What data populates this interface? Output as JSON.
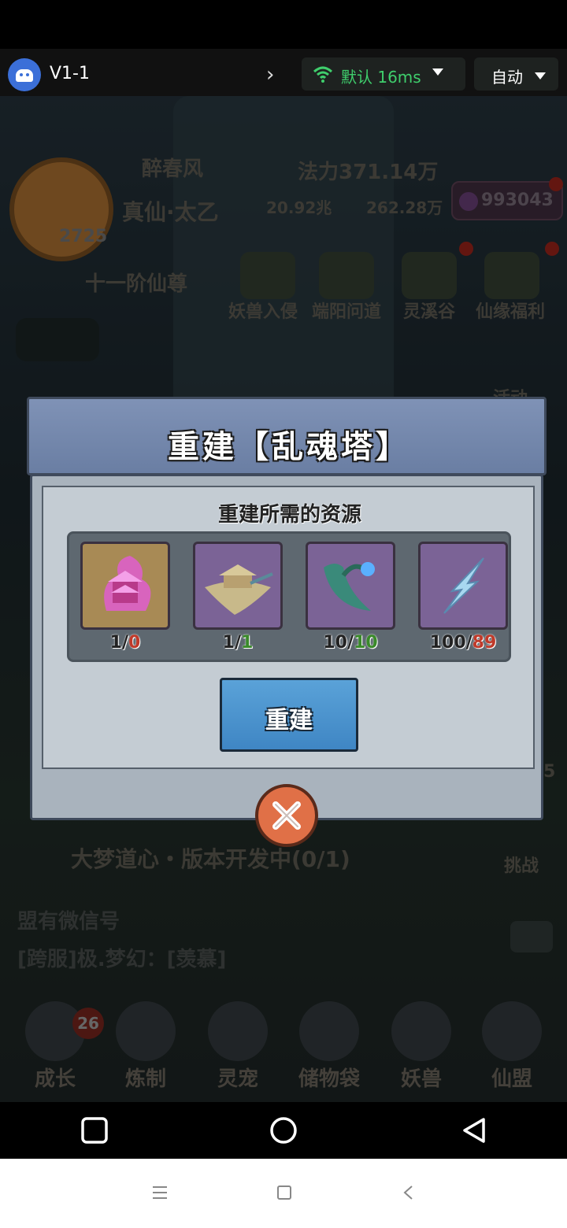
{
  "toolbar": {
    "title": "V1-1",
    "network_label": "默认 16ms",
    "auto_label": "自动"
  },
  "background_game": {
    "player_name": "醉春风",
    "power": "法力371.14万",
    "realm": "真仙·太乙",
    "stat_a": "20.92兆",
    "stat_b": "262.28万",
    "currency": "993043",
    "level": "2725",
    "rank": "十一阶仙尊",
    "events": [
      "妖兽入侵",
      "端阳问道",
      "灵溪谷",
      "仙缘福利"
    ],
    "activity_label": "活动",
    "quest": "大梦道心・版本开发中(0/1)",
    "challenge_label": "挑战",
    "chat_line_1": "盟有微信号",
    "chat_line_2": "[跨服]极.梦幻：[羡慕]",
    "nav": [
      {
        "label": "成长"
      },
      {
        "label": "炼制"
      },
      {
        "label": "灵宠"
      },
      {
        "label": "储物袋"
      },
      {
        "label": "妖兽"
      },
      {
        "label": "仙盟"
      }
    ],
    "growth_badge": "26",
    "side_number": "5"
  },
  "modal": {
    "title": "重建【乱魂塔】",
    "section_title": "重建所需的资源",
    "resources": [
      {
        "icon": "pink-pagoda-icon",
        "need": "1/",
        "have": "0",
        "ok": false
      },
      {
        "icon": "floating-palace-icon",
        "need": "1/",
        "have": "1",
        "ok": true
      },
      {
        "icon": "spirit-herb-icon",
        "need": "10/",
        "have": "10",
        "ok": true
      },
      {
        "icon": "crystal-shard-icon",
        "need": "100/",
        "have": "89",
        "ok": false
      }
    ],
    "rebuild_label": "重建"
  },
  "colors": {
    "header": "#7f92b6",
    "button": "#4a94d0",
    "ok": "#3a8a2a",
    "bad": "#c03a2a",
    "close": "#e07047"
  }
}
